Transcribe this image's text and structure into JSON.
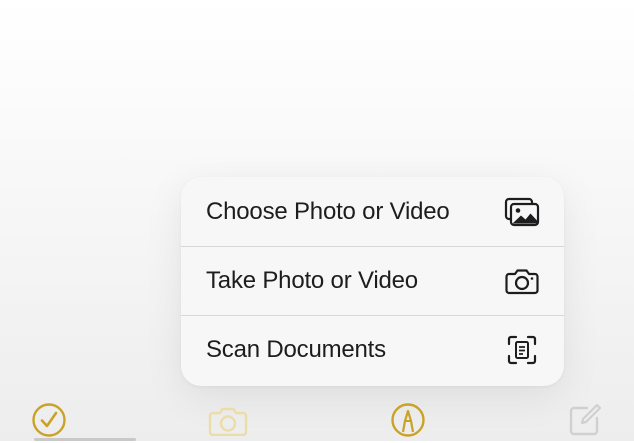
{
  "menu": {
    "items": [
      {
        "label": "Choose Photo or Video",
        "icon": "photo-library-icon"
      },
      {
        "label": "Take Photo or Video",
        "icon": "camera-icon"
      },
      {
        "label": "Scan Documents",
        "icon": "document-scanner-icon"
      }
    ]
  },
  "toolbar": {
    "items": [
      {
        "icon": "checklist-icon",
        "state": "active"
      },
      {
        "icon": "camera-icon",
        "state": "faded"
      },
      {
        "icon": "markup-pen-icon",
        "state": "active"
      },
      {
        "icon": "compose-icon",
        "state": "faded"
      }
    ]
  },
  "colors": {
    "accent": "#C9A227",
    "accent_faded": "#EBDCA8",
    "text": "#1D1D1F",
    "icon": "#1D1D1F",
    "faded_icon": "#D0D0D0",
    "menu_background": "#F7F7F7",
    "separator": "#D7D7D9"
  }
}
